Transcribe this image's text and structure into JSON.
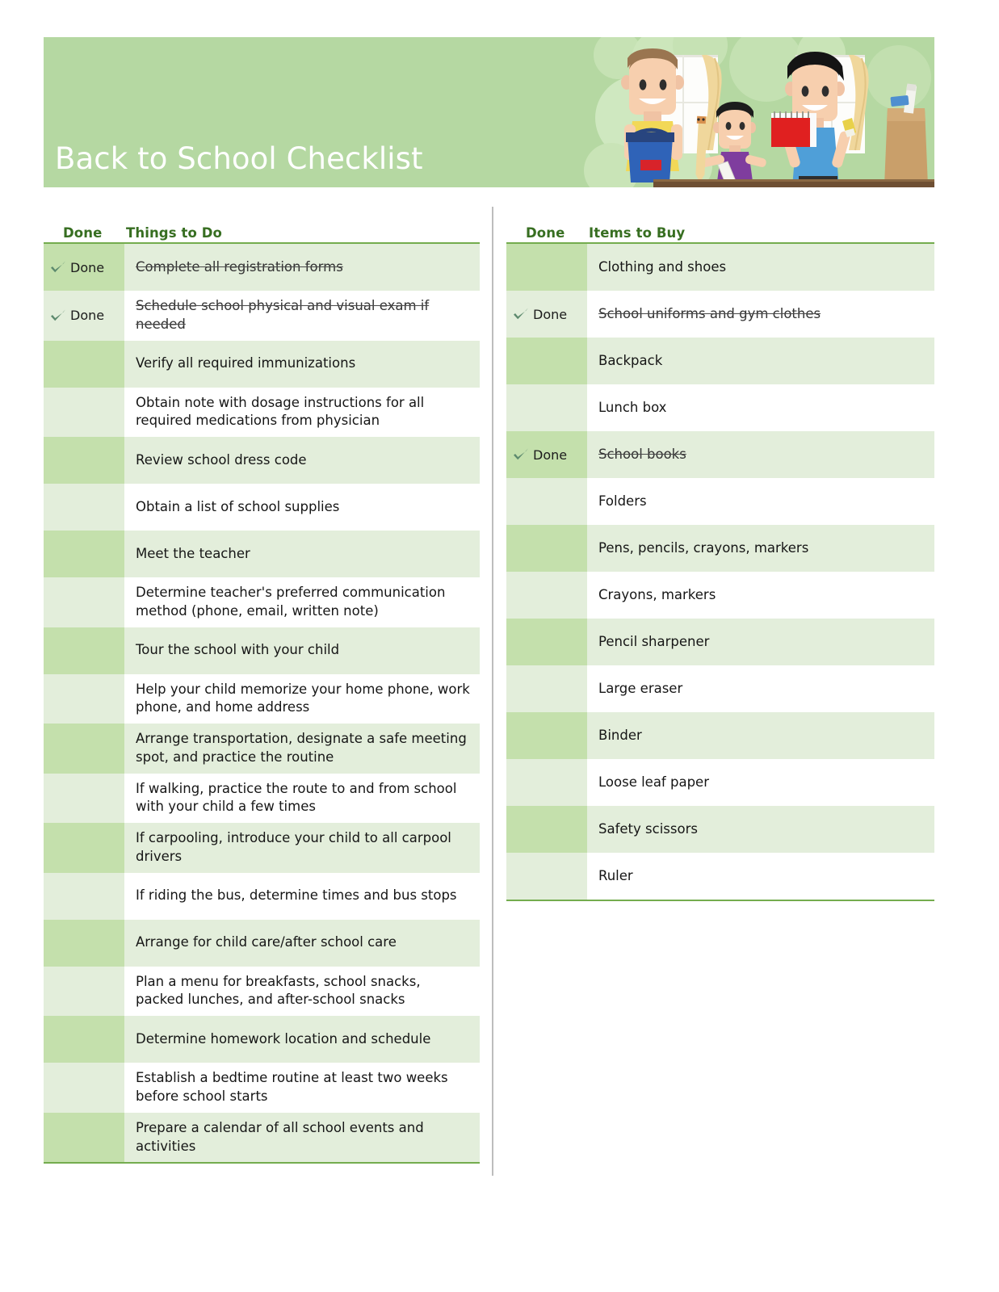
{
  "document": {
    "title": "Back to School Checklist"
  },
  "banner": {
    "title": "Back to School Checklist",
    "background_color": "#b5d8a2",
    "illustration": "family-shopping-for-school-supplies-illustration"
  },
  "theme": {
    "banner_green": "#b5d8a2",
    "row_dark_green": "#c4e0ac",
    "row_light_green": "#e3eedb",
    "rule_green": "#74ac4e",
    "header_text_green": "#376e21",
    "check_green": "#5d8a6e",
    "divider_gray": "#bdbdbd"
  },
  "left_table": {
    "headers": {
      "done": "Done",
      "label": "Things to Do"
    },
    "done_text": "Done",
    "rows": [
      {
        "done": true,
        "text": "Complete all registration forms"
      },
      {
        "done": true,
        "text": "Schedule school physical and visual exam if needed"
      },
      {
        "done": false,
        "text": "Verify all required immunizations"
      },
      {
        "done": false,
        "text": "Obtain note with dosage instructions for all required medications from physician"
      },
      {
        "done": false,
        "text": "Review school dress code"
      },
      {
        "done": false,
        "text": "Obtain a list of school supplies"
      },
      {
        "done": false,
        "text": "Meet the teacher"
      },
      {
        "done": false,
        "text": "Determine teacher's preferred communication method (phone, email, written note)"
      },
      {
        "done": false,
        "text": "Tour the school with your child"
      },
      {
        "done": false,
        "text": "Help your child memorize your home phone, work phone, and home address"
      },
      {
        "done": false,
        "text": "Arrange transportation, designate a safe meeting spot, and practice the routine"
      },
      {
        "done": false,
        "text": "If walking, practice the route to and from school with your child a few times"
      },
      {
        "done": false,
        "text": "If carpooling, introduce your child to all carpool drivers"
      },
      {
        "done": false,
        "text": "If riding the bus, determine times and bus stops"
      },
      {
        "done": false,
        "text": "Arrange for child care/after school care"
      },
      {
        "done": false,
        "text": "Plan a menu for breakfasts, school snacks, packed lunches, and after-school snacks"
      },
      {
        "done": false,
        "text": "Determine homework location and schedule"
      },
      {
        "done": false,
        "text": "Establish a bedtime routine at least two weeks before school starts"
      },
      {
        "done": false,
        "text": "Prepare a calendar of all school events and activities"
      }
    ]
  },
  "right_table": {
    "headers": {
      "done": "Done",
      "label": "Items to Buy"
    },
    "done_text": "Done",
    "rows": [
      {
        "done": false,
        "text": "Clothing and shoes"
      },
      {
        "done": true,
        "text": "School uniforms and gym clothes"
      },
      {
        "done": false,
        "text": "Backpack"
      },
      {
        "done": false,
        "text": "Lunch box"
      },
      {
        "done": true,
        "text": "School books"
      },
      {
        "done": false,
        "text": "Folders"
      },
      {
        "done": false,
        "text": "Pens, pencils, crayons, markers"
      },
      {
        "done": false,
        "text": "Crayons, markers"
      },
      {
        "done": false,
        "text": "Pencil sharpener"
      },
      {
        "done": false,
        "text": "Large eraser"
      },
      {
        "done": false,
        "text": "Binder"
      },
      {
        "done": false,
        "text": "Loose leaf paper"
      },
      {
        "done": false,
        "text": "Safety scissors"
      },
      {
        "done": false,
        "text": "Ruler"
      }
    ]
  }
}
